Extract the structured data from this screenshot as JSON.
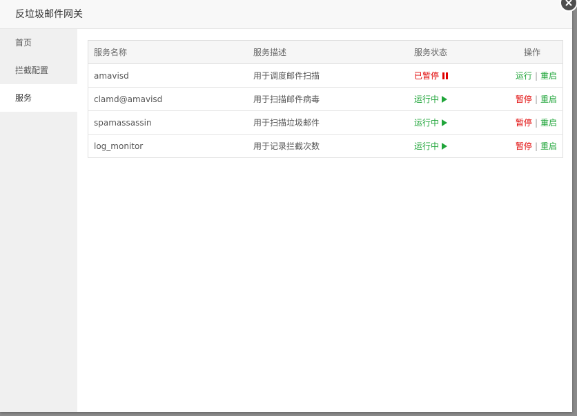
{
  "dialog": {
    "title": "反垃圾邮件网关"
  },
  "sidebar": {
    "items": [
      {
        "label": "首页"
      },
      {
        "label": "拦截配置"
      },
      {
        "label": "服务"
      }
    ]
  },
  "table": {
    "headers": {
      "name": "服务名称",
      "desc": "服务描述",
      "status": "服务状态",
      "op": "操作"
    },
    "rows": [
      {
        "name": "amavisd",
        "desc": "用于调度邮件扫描",
        "status": "已暂停",
        "action1": "运行",
        "action2": "重启"
      },
      {
        "name": "clamd@amavisd",
        "desc": "用于扫描邮件病毒",
        "status": "运行中",
        "action1": "暂停",
        "action2": "重启"
      },
      {
        "name": "spamassassin",
        "desc": "用于扫描垃圾邮件",
        "status": "运行中",
        "action1": "暂停",
        "action2": "重启"
      },
      {
        "name": "log_monitor",
        "desc": "用于记录拦截次数",
        "status": "运行中",
        "action1": "暂停",
        "action2": "重启"
      }
    ],
    "separator": "|"
  },
  "colors": {
    "running": "#20a53a",
    "stopped": "#e00000"
  }
}
